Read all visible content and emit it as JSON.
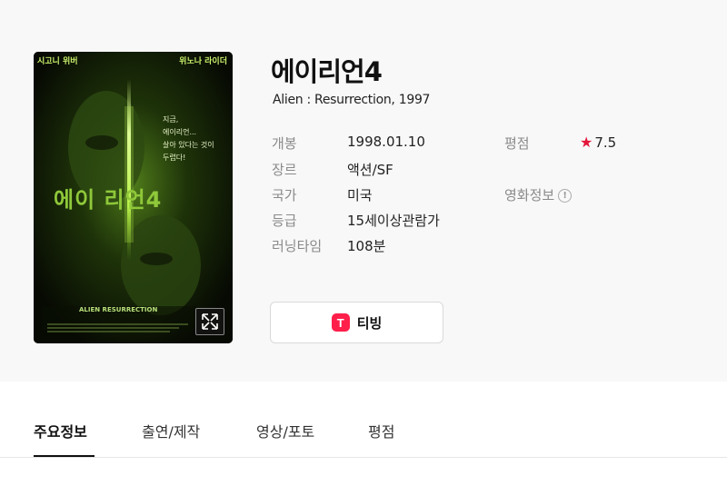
{
  "movie": {
    "title": "에이리언4",
    "subtitle": "Alien : Resurrection, 1997"
  },
  "info": {
    "release_label": "개봉",
    "release_value": "1998.01.10",
    "genre_label": "장르",
    "genre_value": "액션/SF",
    "country_label": "국가",
    "country_value": "미국",
    "grade_label": "등급",
    "grade_value": "15세이상관람가",
    "runtime_label": "러닝타임",
    "runtime_value": "108분",
    "rating_label": "평점",
    "rating_value": "7.5",
    "movieinfo_label": "영화정보"
  },
  "poster": {
    "top_left_text": "시고니 위버",
    "top_right_text": "위노나 라이더",
    "quote_lines": [
      "지금,",
      "에이리언...",
      "살아 있다는 것이",
      "두렵다!"
    ],
    "poster_title": "에이 리언4",
    "english_title": "ALIEN RESURRECTION"
  },
  "ott": {
    "logo_letter": "T",
    "label": "티빙",
    "brand_color": "#ff1f4b"
  },
  "tabs": [
    {
      "label": "주요정보",
      "active": true
    },
    {
      "label": "출연/제작",
      "active": false
    },
    {
      "label": "영상/포토",
      "active": false
    },
    {
      "label": "평점",
      "active": false
    }
  ],
  "colors": {
    "accent_star": "#e4163a",
    "tab_active": "#111111"
  },
  "icons": {
    "expand": "expand-arrows-icon",
    "star": "star-icon",
    "info": "info-circle-icon"
  }
}
